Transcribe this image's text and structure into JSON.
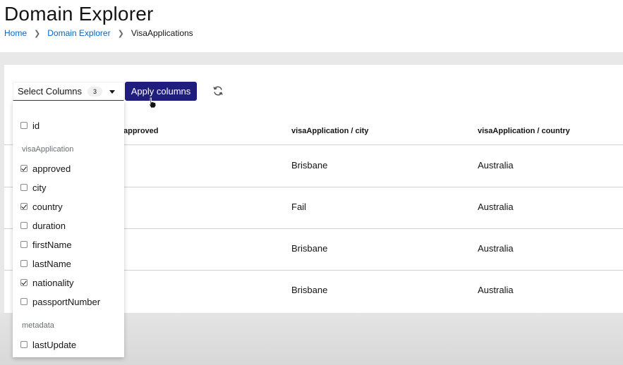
{
  "header": {
    "title": "Domain Explorer",
    "breadcrumb": [
      {
        "label": "Home"
      },
      {
        "label": "Domain Explorer"
      },
      {
        "label": "VisaApplications"
      }
    ]
  },
  "toolbar": {
    "select_label": "Select Columns",
    "selected_count": "3",
    "apply_label": "Apply columns"
  },
  "dropdown": {
    "root_option": {
      "label": "id",
      "checked": false
    },
    "groups": [
      {
        "label": "visaApplication",
        "options": [
          {
            "label": "approved",
            "checked": true
          },
          {
            "label": "city",
            "checked": false
          },
          {
            "label": "country",
            "checked": true
          },
          {
            "label": "duration",
            "checked": false
          },
          {
            "label": "firstName",
            "checked": false
          },
          {
            "label": "lastName",
            "checked": false
          },
          {
            "label": "nationality",
            "checked": true
          },
          {
            "label": "passportNumber",
            "checked": false
          }
        ]
      },
      {
        "label": "metadata",
        "options": [
          {
            "label": "lastUpdate",
            "checked": false
          }
        ]
      }
    ]
  },
  "table": {
    "columns": [
      "approved",
      "visaApplication / city",
      "visaApplication / country"
    ],
    "rows": [
      [
        "",
        "Brisbane",
        "Australia"
      ],
      [
        "",
        "Fail",
        "Australia"
      ],
      [
        "",
        "Brisbane",
        "Australia"
      ],
      [
        "",
        "Brisbane",
        "Australia"
      ]
    ]
  },
  "colors": {
    "primary": "#1f1d7e",
    "link": "#0066cc"
  }
}
